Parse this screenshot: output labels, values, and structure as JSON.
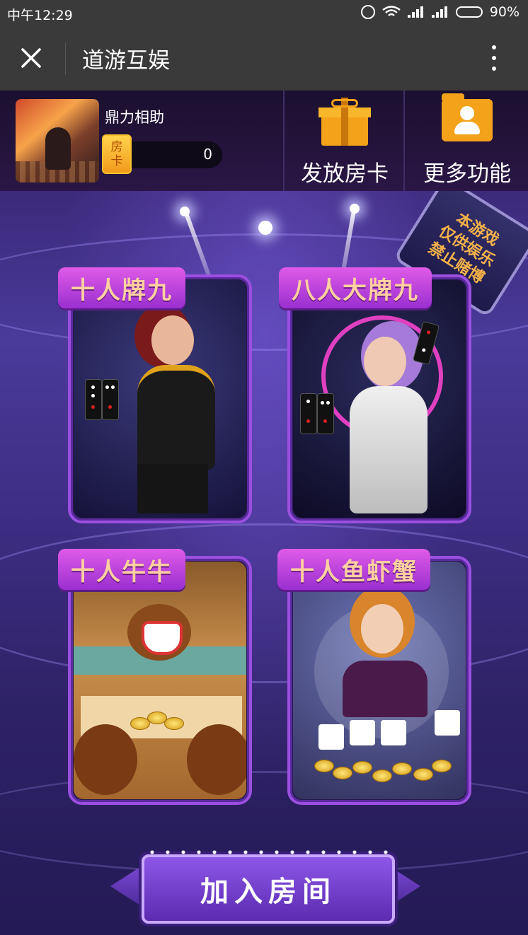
{
  "status_bar": {
    "time": "中午12:29",
    "battery": "90%",
    "battery_level": 0.9
  },
  "title_bar": {
    "title": "道游互娱",
    "close_icon": "close-icon",
    "menu_icon": "more-vertical-icon"
  },
  "header": {
    "username": "鼎力相助",
    "card_badge_top": "房",
    "card_badge_bottom": "卡",
    "room_cards": "0",
    "buttons": [
      {
        "label": "发放房卡",
        "icon": "gift-icon"
      },
      {
        "label": "更多功能",
        "icon": "user-folder-icon"
      }
    ]
  },
  "disclaimer": {
    "lines": [
      "本游戏",
      "仅供娱乐",
      "禁止赌博"
    ]
  },
  "games": [
    {
      "title": "十人牌九"
    },
    {
      "title": "八人大牌九"
    },
    {
      "title": "十人牛牛"
    },
    {
      "title": "十人鱼虾蟹"
    }
  ],
  "join_button": {
    "label": "加入房间"
  },
  "colors": {
    "accent_purple": "#9b4fe0",
    "gold": "#f3a21a",
    "bar_bg": "#3a3a3a"
  }
}
